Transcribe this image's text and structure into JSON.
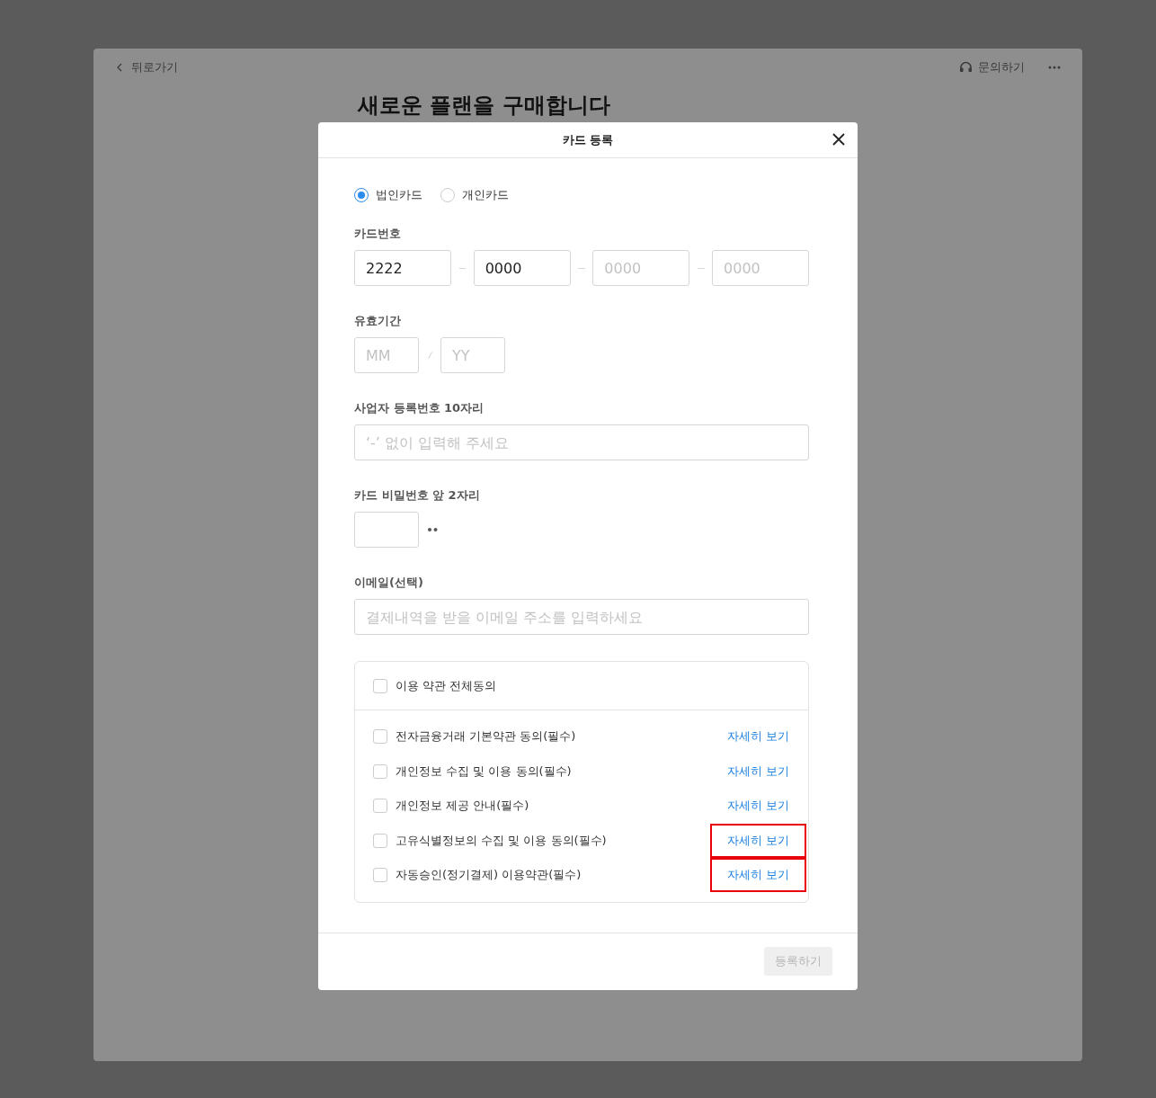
{
  "page": {
    "back_label": "뒤로가기",
    "contact_label": "문의하기",
    "title": "새로운 플랜을 구매합니다"
  },
  "modal": {
    "title": "카드 등록",
    "card_types": [
      {
        "label": "법인카드",
        "selected": true
      },
      {
        "label": "개인카드",
        "selected": false
      }
    ],
    "card_number": {
      "label": "카드번호",
      "fields": [
        {
          "value": "2222"
        },
        {
          "value": "0000"
        },
        {
          "placeholder": "0000"
        },
        {
          "placeholder": "0000"
        }
      ]
    },
    "expiry": {
      "label": "유효기간",
      "fields": [
        {
          "placeholder": "MM"
        },
        {
          "placeholder": "YY"
        }
      ]
    },
    "business_number": {
      "label": "사업자 등록번호 10자리",
      "placeholder": "‘-’ 없이 입력해 주세요"
    },
    "password": {
      "label": "카드 비밀번호 앞 2자리"
    },
    "email": {
      "label": "이메일(선택)",
      "placeholder": "결제내역을 받을 이메일 주소를 입력하세요"
    },
    "terms": {
      "all": {
        "label": "이용 약관 전체동의",
        "checked": false
      },
      "items": [
        {
          "label": "전자금융거래 기본약관 동의(필수)",
          "checked": false,
          "link": "자세히 보기",
          "highlighted": false
        },
        {
          "label": "개인정보 수집 및 이용 동의(필수)",
          "checked": false,
          "link": "자세히 보기",
          "highlighted": false
        },
        {
          "label": "개인정보 제공 안내(필수)",
          "checked": false,
          "link": "자세히 보기",
          "highlighted": false
        },
        {
          "label": "고유식별정보의 수집 및 이용 동의(필수)",
          "checked": false,
          "link": "자세히 보기",
          "highlighted": true
        },
        {
          "label": "자동승인(정기결제) 이용약관(필수)",
          "checked": false,
          "link": "자세히 보기",
          "highlighted": true
        }
      ]
    },
    "submit": {
      "label": "등록하기",
      "disabled": true
    }
  }
}
